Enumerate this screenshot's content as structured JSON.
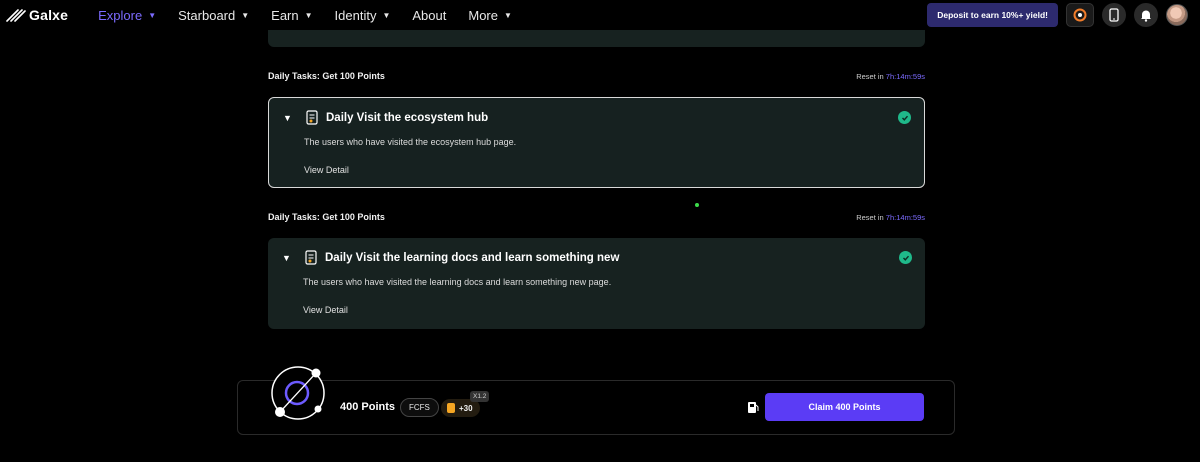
{
  "nav": {
    "brand": "Galxe",
    "items": [
      {
        "label": "Explore",
        "active": true,
        "has_caret": true
      },
      {
        "label": "Starboard",
        "active": false,
        "has_caret": true
      },
      {
        "label": "Earn",
        "active": false,
        "has_caret": true
      },
      {
        "label": "Identity",
        "active": false,
        "has_caret": true
      },
      {
        "label": "About",
        "active": false,
        "has_caret": false
      },
      {
        "label": "More",
        "active": false,
        "has_caret": true
      }
    ],
    "deposit_label": "Deposit to earn 10%+ yield!",
    "icons": [
      "galxe-badge-icon",
      "mobile-icon",
      "bell-icon",
      "avatar"
    ]
  },
  "sections": [
    {
      "title": "Daily Tasks: Get 100 Points",
      "reset_prefix": "Reset in",
      "reset_time": "7h:14m:59s",
      "task": {
        "title": "Daily Visit the ecosystem hub",
        "description": "The users who have visited the ecosystem hub page.",
        "detail_link": "View Detail",
        "completed": true,
        "selected": true
      }
    },
    {
      "title": "Daily Tasks: Get 100 Points",
      "reset_prefix": "Reset in",
      "reset_time": "7h:14m:59s",
      "task": {
        "title": "Daily Visit the learning docs and learn something new",
        "description": "The users who have visited the learning docs and learn something new page.",
        "detail_link": "View Detail",
        "completed": true,
        "selected": false
      }
    }
  ],
  "claim": {
    "points": "400 Points",
    "distribution": "FCFS",
    "bonus": "+30",
    "multiplier": "X1.2",
    "button_label": "Claim 400 Points"
  },
  "colors": {
    "accent": "#7c6bff",
    "card_bg": "#172220",
    "success": "#1fb98a",
    "claim_button": "#5b3cf5",
    "deposit_bg": "#2d2a6e"
  }
}
